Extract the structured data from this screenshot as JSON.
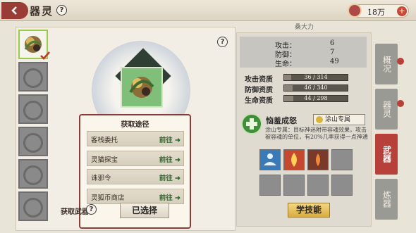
{
  "header": {
    "title": "器灵",
    "currency": "18万"
  },
  "item": {
    "name": "桑大力"
  },
  "acquire": {
    "title": "获取途径",
    "routes": [
      {
        "label": "客栈委托",
        "go": "前往"
      },
      {
        "label": "灵猫探宝",
        "go": "前往"
      },
      {
        "label": "诛邪令",
        "go": "前往"
      },
      {
        "label": "灵狐币商店",
        "go": "前往"
      }
    ]
  },
  "bottom": {
    "label": "获取武器",
    "select_label": "已选择"
  },
  "stats": [
    {
      "label": "攻击：",
      "value": "6"
    },
    {
      "label": "防御：",
      "value": "7"
    },
    {
      "label": "生命：",
      "value": "49"
    }
  ],
  "aptitude": [
    {
      "label": "攻击资质",
      "text": "36 / 314",
      "fraction": 0.115
    },
    {
      "label": "防御资质",
      "text": "46 / 340",
      "fraction": 0.135
    },
    {
      "label": "生命资质",
      "text": "44 / 298",
      "fraction": 0.148
    }
  ],
  "skill": {
    "name": "恼羞成怒",
    "tag": "涂山专属",
    "description": "涂山专属：目标神迷附带容魂效果，攻击被容魂的单位，有20%几率获得一点神通"
  },
  "learn_label": "学技能",
  "tabs": [
    {
      "label": "概况",
      "active": false
    },
    {
      "label": "器灵",
      "active": false
    },
    {
      "label": "武器",
      "active": true
    },
    {
      "label": "炼器",
      "active": false
    }
  ]
}
